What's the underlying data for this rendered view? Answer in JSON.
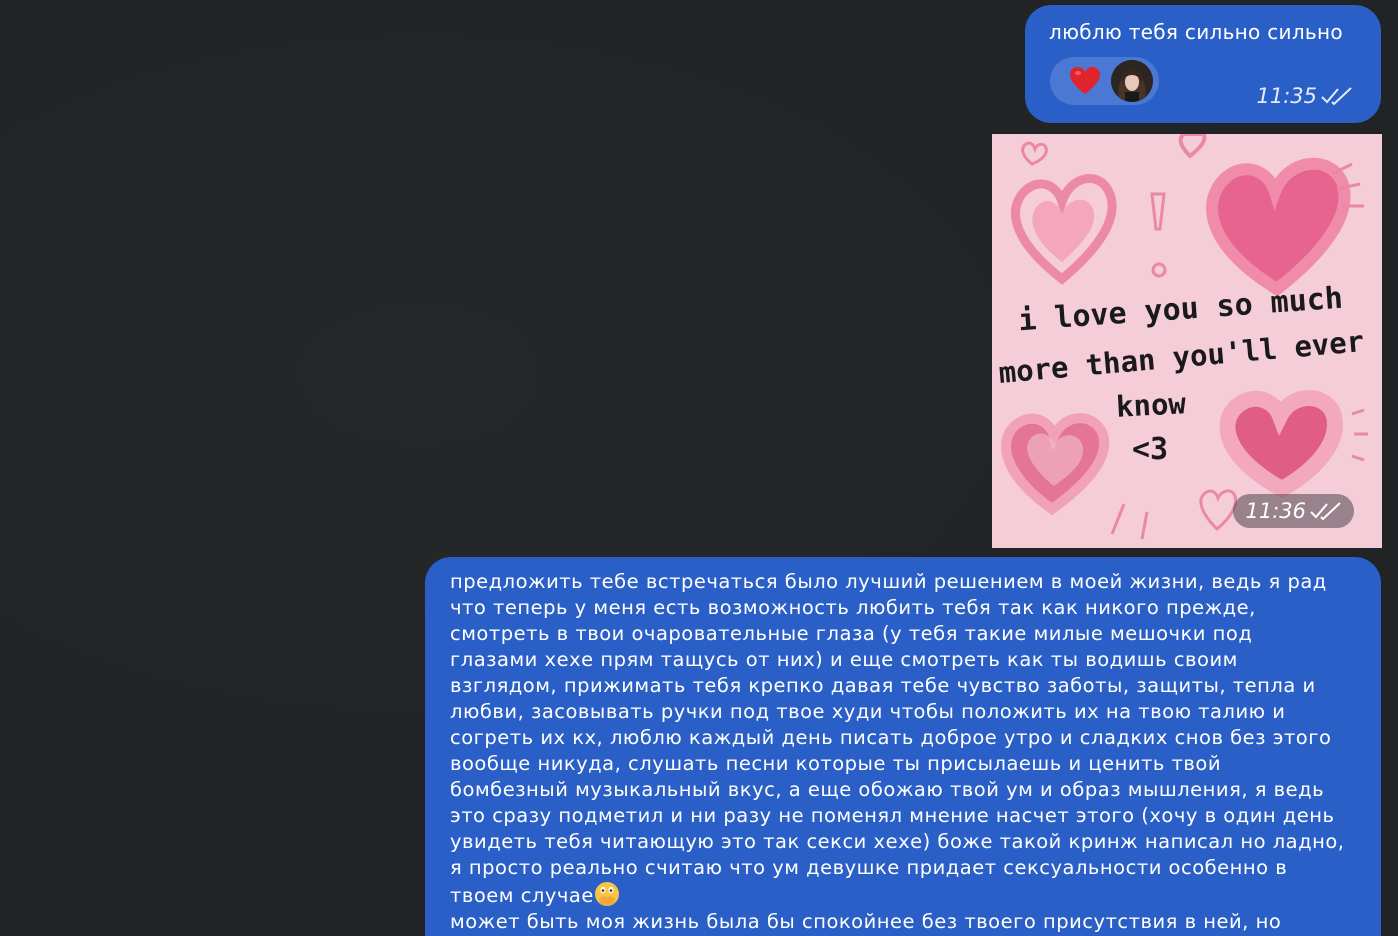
{
  "messages": [
    {
      "text": "люблю тебя сильно сильно",
      "time": "11:35",
      "status_icon": "double-check-icon",
      "reactions": [
        {
          "type": "emoji",
          "icon": "red-heart-icon"
        },
        {
          "type": "avatar",
          "icon": "user-avatar"
        }
      ]
    },
    {
      "type": "image",
      "image_text": [
        "i love you so much",
        "more than you'll ever",
        "know",
        "<3"
      ],
      "time": "11:36",
      "status_icon": "double-check-icon"
    },
    {
      "lines": [
        "предложить тебе встречаться было лучший решением в моей жизни, ведь я рад",
        "что теперь у меня есть возможность любить тебя так как никого прежде,",
        "смотреть в твои очаровательные глаза (у тебя такие милые мешочки под",
        "глазами хехе прям тащусь от них) и еще смотреть как ты водишь своим",
        "взглядом, прижимать тебя крепко давая тебе чувство заботы, защиты, тепла и",
        "любви, засовывать ручки под твое худи чтобы положить их на твою талию и",
        "согреть их кх, люблю каждый день писать доброе утро и сладких снов без этого",
        "вообще никуда, слушать песни которые ты присылаешь и ценить твой",
        "бомбезный музыкальный вкус, а еще обожаю твой ум и образ мышления, я ведь",
        "это сразу подметил и ни разу не поменял мнение насчет этого (хочу в один день",
        "увидеть тебя читающую это так секси хехе) боже такой кринж написал но ладно,",
        "я просто реально считаю что ум девушке придает сексуальности особенно в",
        "твоем случае",
        "может быть моя жизнь была бы спокойнее без твоего присутствия в ней, но"
      ],
      "inline_emoji_icon": "face-with-open-eyes-and-hand-over-mouth-icon"
    }
  ],
  "colors": {
    "background": "#222426",
    "bubble": "#2a5fc7",
    "reaction_pill": "#4a78d3",
    "image_background": "#f4cdd8"
  }
}
